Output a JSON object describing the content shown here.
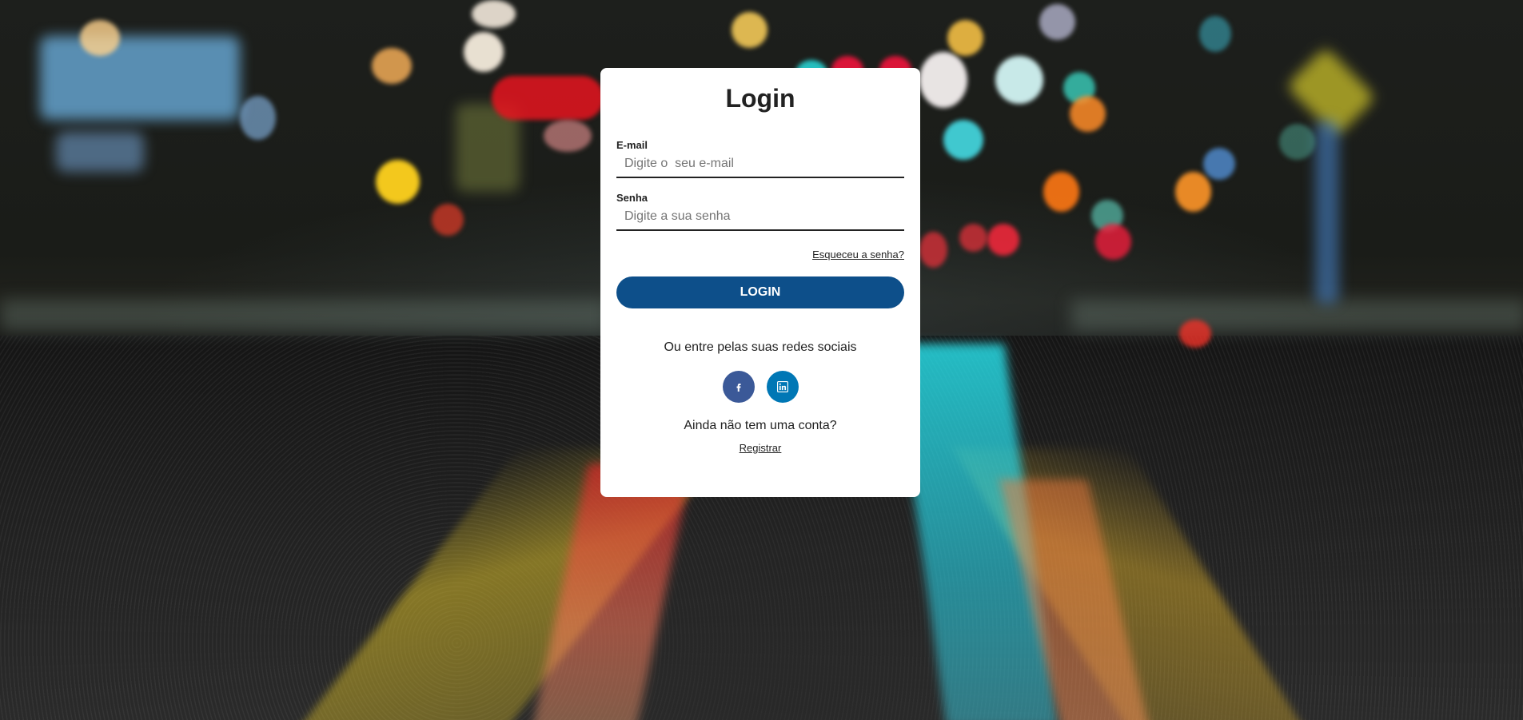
{
  "login": {
    "title": "Login",
    "email": {
      "label": "E-mail",
      "placeholder": "Digite o  seu e-mail",
      "value": ""
    },
    "password": {
      "label": "Senha",
      "placeholder": "Digite a sua senha",
      "value": ""
    },
    "forgot_label": "Esqueceu a senha?",
    "submit_label": "LOGIN",
    "social_prompt": "Ou entre pelas suas redes sociais",
    "social": [
      {
        "network": "facebook",
        "icon": "facebook-icon",
        "color": "#3b5998"
      },
      {
        "network": "linkedin",
        "icon": "linkedin-icon",
        "color": "#0077b5"
      }
    ],
    "no_account_text": "Ainda não tem uma conta?",
    "register_label": "Registrar"
  },
  "colors": {
    "primary": "#0d4f8a",
    "card": "#ffffff",
    "text": "#222222"
  }
}
